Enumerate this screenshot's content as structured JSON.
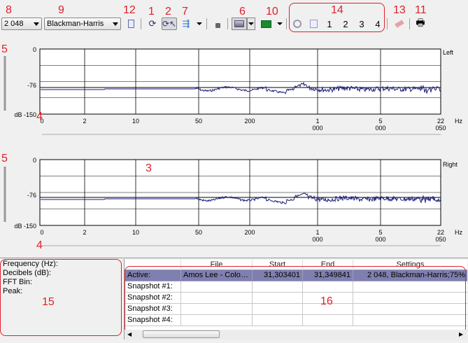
{
  "toolbar": {
    "fft_size": "2 048",
    "window": "Blackman-Harris",
    "snapshots": [
      "1",
      "2",
      "3",
      "4"
    ]
  },
  "annotations": {
    "a1": "1",
    "a2": "2",
    "a3": "3",
    "a4a": "4",
    "a4b": "4",
    "a5a": "5",
    "a5b": "5",
    "a6": "6",
    "a7": "7",
    "a8": "8",
    "a9": "9",
    "a10": "10",
    "a11": "11",
    "a12": "12",
    "a13": "13",
    "a14": "14",
    "a15": "15",
    "a16": "16"
  },
  "plots": {
    "left": {
      "channel": "Left"
    },
    "right": {
      "channel": "Right"
    },
    "y_ticks": [
      "0",
      "-76",
      "dB -150"
    ],
    "x_ticks": [
      "0",
      "2",
      "10",
      "50",
      "200",
      "1 000",
      "5 000",
      "22 050"
    ],
    "x_unit": "Hz"
  },
  "info": {
    "labels": [
      "Frequency (Hz):",
      "Decibels (dB):",
      "FFT Bin:",
      "Peak:"
    ]
  },
  "table": {
    "headers": [
      "",
      "File",
      "Start",
      "End",
      "Settings"
    ],
    "rows": [
      [
        "Active:",
        "Amos Lee - Colors…",
        "31,303401",
        "31,349841",
        "2 048, Blackman-Harris;75%"
      ],
      [
        "Snapshot #1:",
        "",
        "",
        "",
        ""
      ],
      [
        "Snapshot #2:",
        "",
        "",
        "",
        ""
      ],
      [
        "Snapshot #3:",
        "",
        "",
        "",
        ""
      ],
      [
        "Snapshot #4:",
        "",
        "",
        "",
        ""
      ]
    ]
  },
  "colors": {
    "curve": "#1a1a7a",
    "active_row": "#7f80b0",
    "annotation": "#e0202a"
  }
}
